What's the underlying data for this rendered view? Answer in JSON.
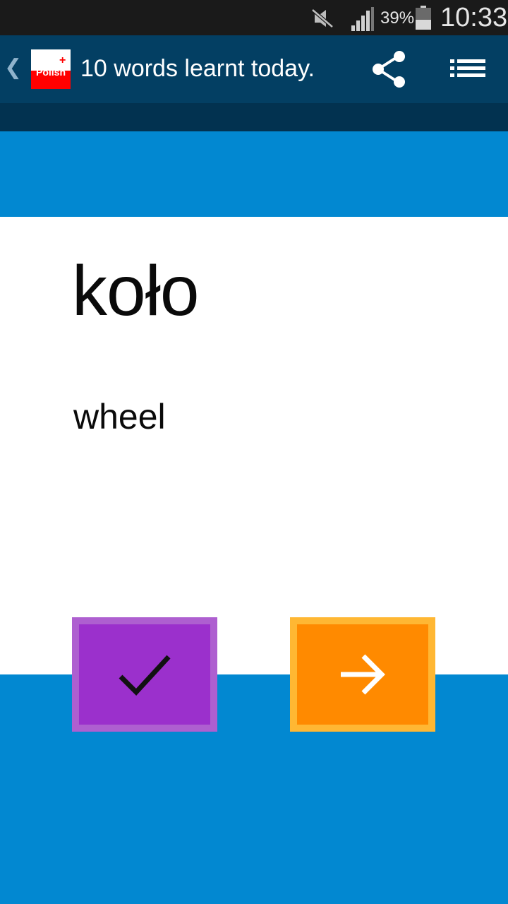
{
  "status_bar": {
    "battery_percent": "39%",
    "time": "10:33",
    "icons": [
      "mute-icon",
      "signal-icon",
      "battery-icon"
    ]
  },
  "app_bar": {
    "back_glyph": "❮",
    "logo_text": "Polish",
    "logo_plus": "+",
    "title": "10 words learnt today.",
    "icons": [
      "share-icon",
      "list-menu-icon"
    ]
  },
  "card": {
    "word": "koło",
    "translation": "wheel"
  },
  "actions": {
    "known_icon": "checkmark-icon",
    "next_icon": "arrow-right-icon"
  },
  "colors": {
    "accent_blue": "#0288d1",
    "app_bar": "#033f63",
    "known_button": "#9b30cc",
    "next_button": "#ff8a00"
  }
}
